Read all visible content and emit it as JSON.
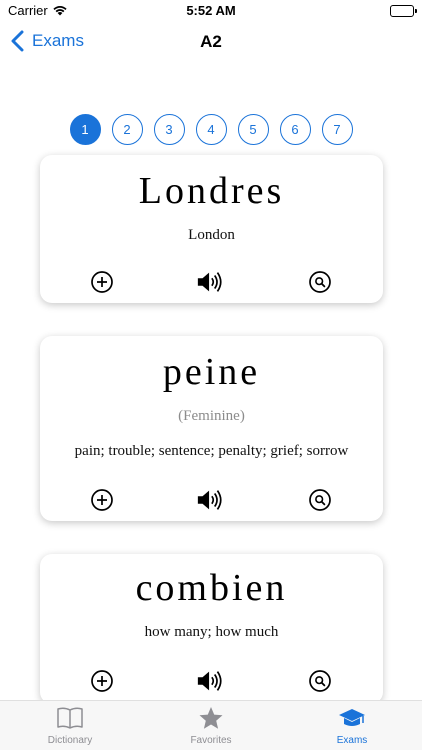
{
  "status_bar": {
    "carrier": "Carrier",
    "time": "5:52 AM"
  },
  "nav": {
    "back_label": "Exams",
    "title": "A2"
  },
  "pager": {
    "pages": [
      "1",
      "2",
      "3",
      "4",
      "5",
      "6",
      "7"
    ],
    "active_page": "1"
  },
  "cards": [
    {
      "word": "Londres",
      "gender": "",
      "translation": "London"
    },
    {
      "word": "peine",
      "gender": "(Feminine)",
      "translation": "pain; trouble; sentence; penalty; grief; sorrow"
    },
    {
      "word": "combien",
      "gender": "",
      "translation": "how many; how much"
    }
  ],
  "card_actions": [
    "add-icon",
    "speaker-icon",
    "lookup-icon"
  ],
  "tabs": [
    {
      "label": "Dictionary",
      "icon": "book-icon",
      "active": false
    },
    {
      "label": "Favorites",
      "icon": "star-icon",
      "active": false
    },
    {
      "label": "Exams",
      "icon": "graduation-cap-icon",
      "active": true
    }
  ],
  "colors": {
    "accent": "#1a73d9",
    "inactive": "#8e8e93"
  }
}
